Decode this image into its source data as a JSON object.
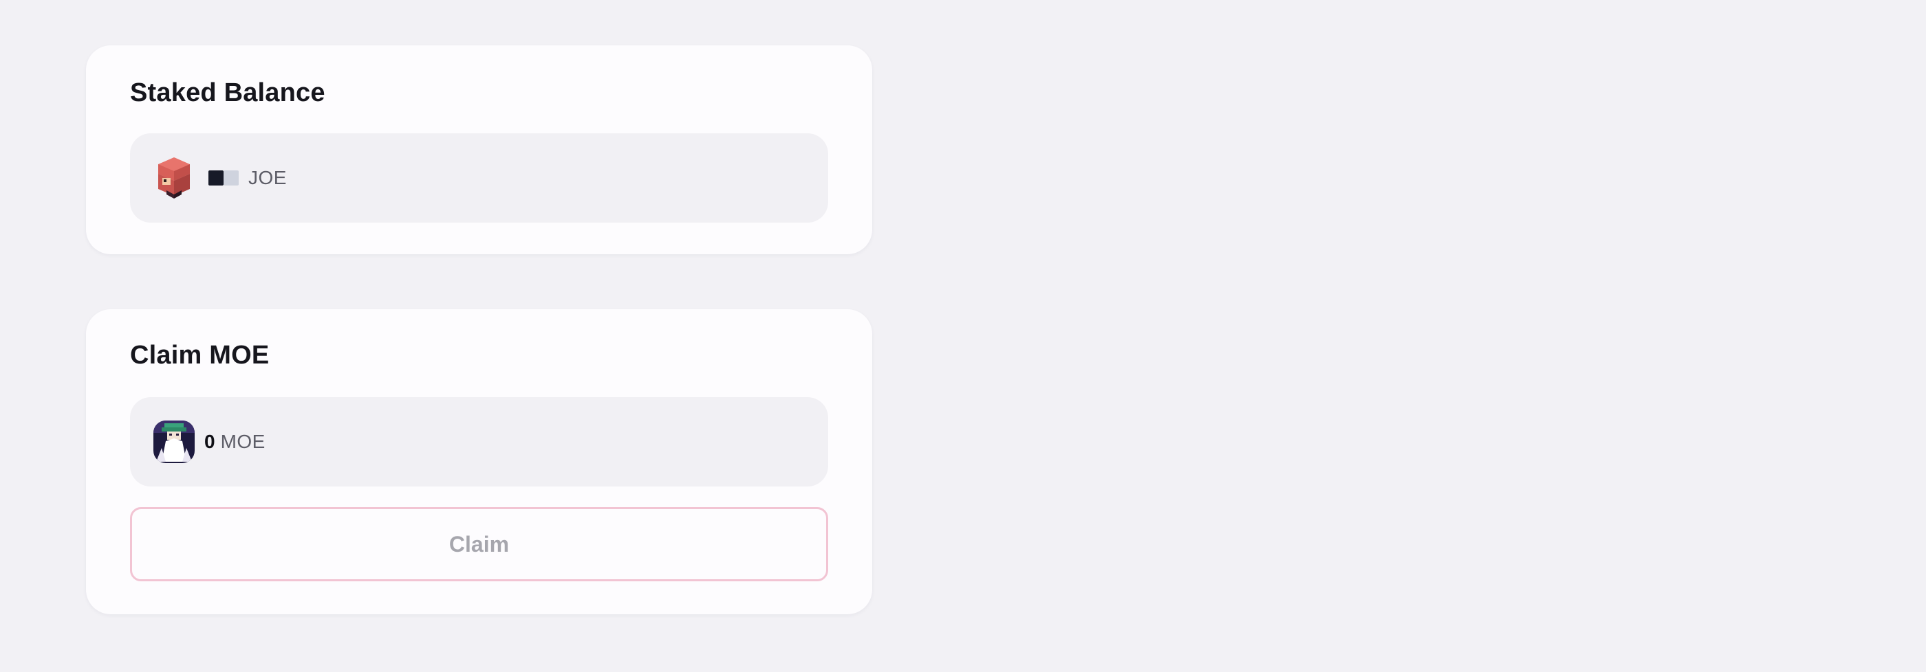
{
  "staked_balance": {
    "title": "Staked Balance",
    "token": {
      "icon": "joe-token-icon",
      "symbol": "JOE",
      "amount_state": "loading"
    }
  },
  "claim": {
    "title": "Claim MOE",
    "token": {
      "icon": "moe-token-icon",
      "amount": "0",
      "symbol": "MOE"
    },
    "button_label": "Claim"
  },
  "colors": {
    "background": "#f2f1f5",
    "card": "#fdfcfe",
    "token_box": "#f1f0f4",
    "button_border": "#f2c4d3",
    "button_text_disabled": "#a6a6ad"
  }
}
